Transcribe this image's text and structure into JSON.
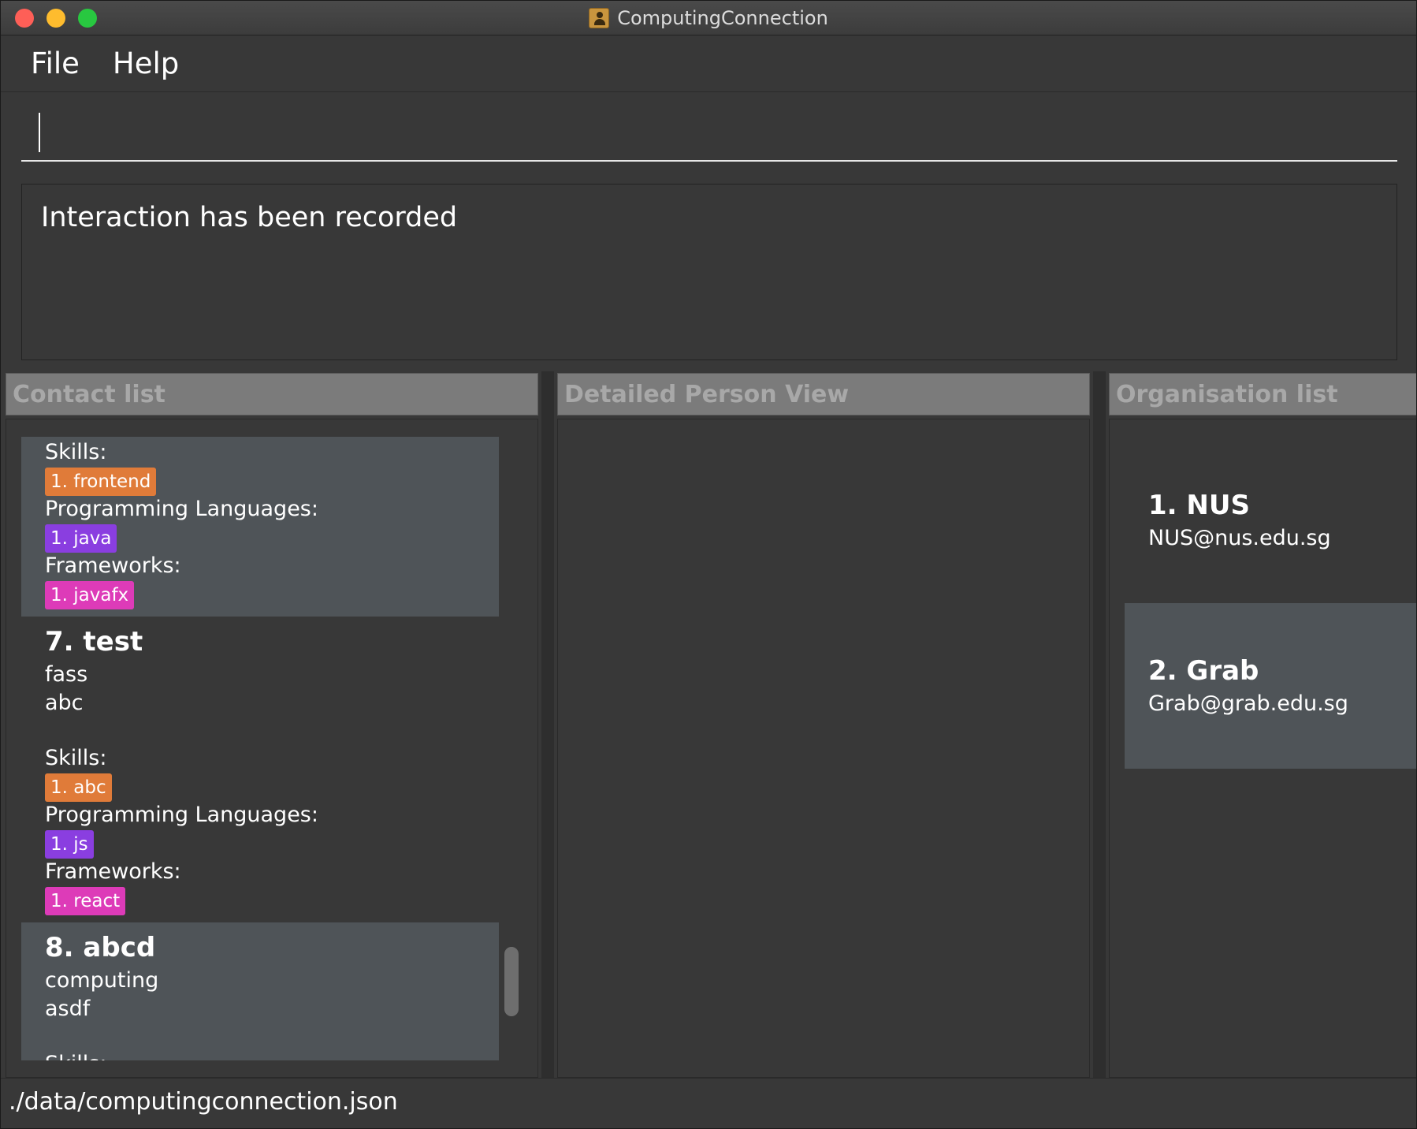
{
  "window": {
    "title": "ComputingConnection"
  },
  "menu": {
    "file": "File",
    "help": "Help"
  },
  "command": {
    "value": ""
  },
  "result": {
    "message": "Interaction has been recorded"
  },
  "panels": {
    "contacts_title": "Contact list",
    "detail_title": "Detailed Person View",
    "orgs_title": "Organisation list"
  },
  "contacts": {
    "partial_top": {
      "skills_label": "Skills:",
      "skills_tag": "1. frontend",
      "langs_label": "Programming Languages:",
      "langs_tag": "1. java",
      "frameworks_label": "Frameworks:",
      "frameworks_tag": "1. javafx"
    },
    "items": [
      {
        "name": "7.  test",
        "line1": "fass",
        "line2": "abc",
        "skills_label": "Skills:",
        "skills_tag": "1. abc",
        "langs_label": "Programming Languages:",
        "langs_tag": "1. js",
        "frameworks_label": "Frameworks:",
        "frameworks_tag": "1. react"
      },
      {
        "name": "8.  abcd",
        "line1": "computing",
        "line2": "asdf",
        "skills_label": "Skills:"
      }
    ]
  },
  "organisations": [
    {
      "name": "1.  NUS",
      "email": "NUS@nus.edu.sg"
    },
    {
      "name": "2.  Grab",
      "email": "Grab@grab.edu.sg"
    }
  ],
  "status": {
    "path": "./data/computingconnection.json"
  },
  "colors": {
    "skill_tag": "#e07b39",
    "language_tag": "#8a3ee0",
    "framework_tag": "#dd3bb8",
    "card_light": "#4f5458",
    "card_dark": "#383838"
  }
}
